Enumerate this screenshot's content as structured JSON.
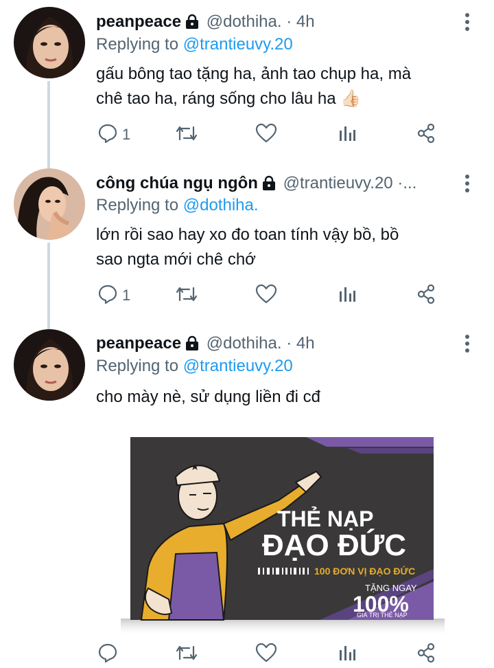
{
  "colors": {
    "text": "#0f1419",
    "muted": "#536471",
    "link": "#1d9bf0",
    "thread": "#cfd9de"
  },
  "tweets": [
    {
      "name": "peanpeace",
      "handle": "@dothiha.",
      "dot": "·",
      "time": "4h",
      "reply_prefix": "Replying to ",
      "reply_to": "@trantieuvy.20",
      "text_line1": "gấu bông tao tặng ha, ảnh tao chụp ha, mà",
      "text_line2": "chê tao ha, ráng sống cho lâu ha 👍🏻",
      "reply_count": "1",
      "icons": {
        "lock": "lock-icon",
        "more": "more-vertical-icon",
        "reply": "reply-icon",
        "retweet": "retweet-icon",
        "like": "heart-icon",
        "views": "views-icon",
        "share": "share-icon"
      }
    },
    {
      "name": "công chúa ngụ ngôn",
      "handle": "@trantieuvy.20",
      "dot": "·",
      "time": "...",
      "reply_prefix": "Replying to ",
      "reply_to": "@dothiha.",
      "text_line1": "lớn rồi sao hay xo đo toan tính vậy bồ, bồ",
      "text_line2": "sao ngta mới chê chớ",
      "reply_count": "1"
    },
    {
      "name": "peanpeace",
      "handle": "@dothiha.",
      "dot": "·",
      "time": "4h",
      "reply_prefix": "Replying to ",
      "reply_to": "@trantieuvy.20",
      "text_line1": "cho mày nè, sử dụng liền đi cđ",
      "reply_count": ""
    }
  ],
  "media": {
    "title1": "THẺ NẠP",
    "title2": "ĐẠO ĐỨC",
    "subtitle": "100 ĐƠN VỊ ĐẠO ĐỨC",
    "promo1": "TẶNG NGAY",
    "promo2": "100%",
    "promo3": "GIÁ TRỊ THẺ NẠP",
    "colors": {
      "background": "#3a3838",
      "purple": "#7a5aa6",
      "yellow": "#e8ad2c",
      "white": "#ffffff"
    }
  }
}
